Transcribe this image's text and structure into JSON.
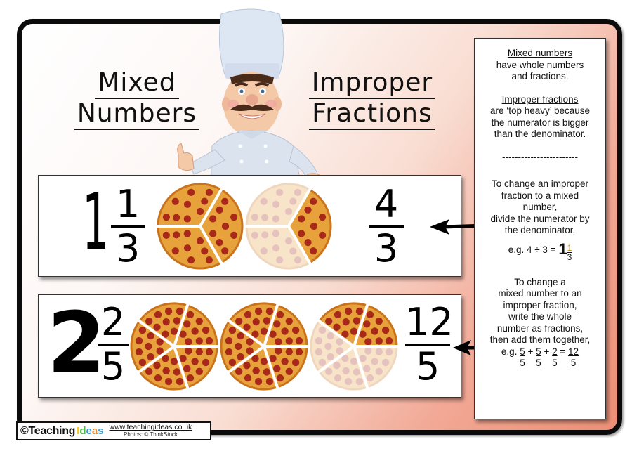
{
  "titles": {
    "mixed": [
      "Mixed",
      "Numbers"
    ],
    "improper": [
      "Improper",
      "Fractions"
    ]
  },
  "example_1": {
    "mixed_whole": "1",
    "mixed_numerator": "1",
    "mixed_denominator": "3",
    "improper_numerator": "4",
    "improper_denominator": "3",
    "pizzas": [
      {
        "slices": 3,
        "filled": 3
      },
      {
        "slices": 3,
        "filled": 1
      }
    ]
  },
  "example_2": {
    "mixed_whole": "2",
    "mixed_numerator": "2",
    "mixed_denominator": "5",
    "improper_numerator": "12",
    "improper_denominator": "5",
    "pizzas": [
      {
        "slices": 5,
        "filled": 5
      },
      {
        "slices": 5,
        "filled": 5
      },
      {
        "slices": 5,
        "filled": 2
      }
    ]
  },
  "info_panel": {
    "mixed_heading": "Mixed numbers",
    "mixed_text_1": "have whole numbers",
    "mixed_text_2": "and fractions.",
    "improper_heading": "Improper fractions",
    "improper_text_1": "are ‘top heavy’ because",
    "improper_text_2": "the numerator is bigger",
    "improper_text_3": "than the denominator.",
    "divider": "------------------------",
    "to_mixed_1": "To change an improper",
    "to_mixed_2": "fraction to a mixed",
    "to_mixed_3": "number,",
    "to_mixed_4": "divide the numerator by",
    "to_mixed_5": "the denominator,",
    "to_mixed_eg": "e.g. 4 ÷ 3 =",
    "to_mixed_eg_whole": "1",
    "to_mixed_eg_num": "1",
    "to_mixed_eg_den": "3",
    "to_improper_1": "To change a",
    "to_improper_2": "mixed number to an",
    "to_improper_3": "improper fraction,",
    "to_improper_4": "write the whole",
    "to_improper_5": "number as fractions,",
    "to_improper_6": "then add them together,",
    "to_improper_eg_prefix": "e.g.",
    "to_improper_eg_terms": [
      {
        "n": "5",
        "d": "5"
      },
      {
        "n": "5",
        "d": "5"
      },
      {
        "n": "2",
        "d": "5"
      },
      {
        "n": "12",
        "d": "5"
      }
    ],
    "to_improper_eg_ops": [
      "+",
      "+",
      "="
    ]
  },
  "footer": {
    "copyright": "©Teaching",
    "ideas_letters": [
      "I",
      "d",
      "e",
      "a",
      "s"
    ],
    "ideas_colors": [
      "#f5c518",
      "#4db848",
      "#2f9be0",
      "#f08a24",
      "#3aa6d8"
    ],
    "url": "www.teachingideas.co.uk",
    "credit": "Photos: © ThinkStock"
  },
  "colors": {
    "pizza_crust": "#c9741c",
    "pizza_cheese": "#e7a23c",
    "pepperoni": "#a8281a",
    "background_accent": "#ec8e75"
  }
}
